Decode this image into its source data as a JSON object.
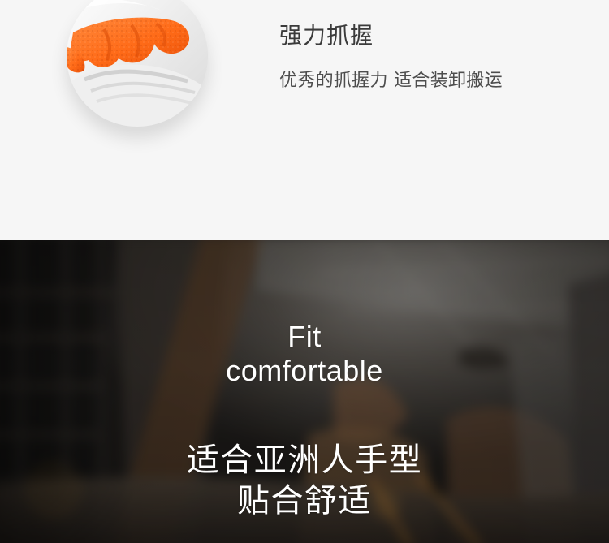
{
  "feature": {
    "title": "强力抓握",
    "description": "优秀的抓握力  适合装卸搬运"
  },
  "hero": {
    "english_line_1": "Fit",
    "english_line_2": "comfortable",
    "chinese_line_1": "适合亚洲人手型",
    "chinese_line_2": "贴合舒适"
  },
  "colors": {
    "glove_orange": "#ff6b18",
    "page_background": "#f6f6f6",
    "hero_text": "#ffffff"
  }
}
